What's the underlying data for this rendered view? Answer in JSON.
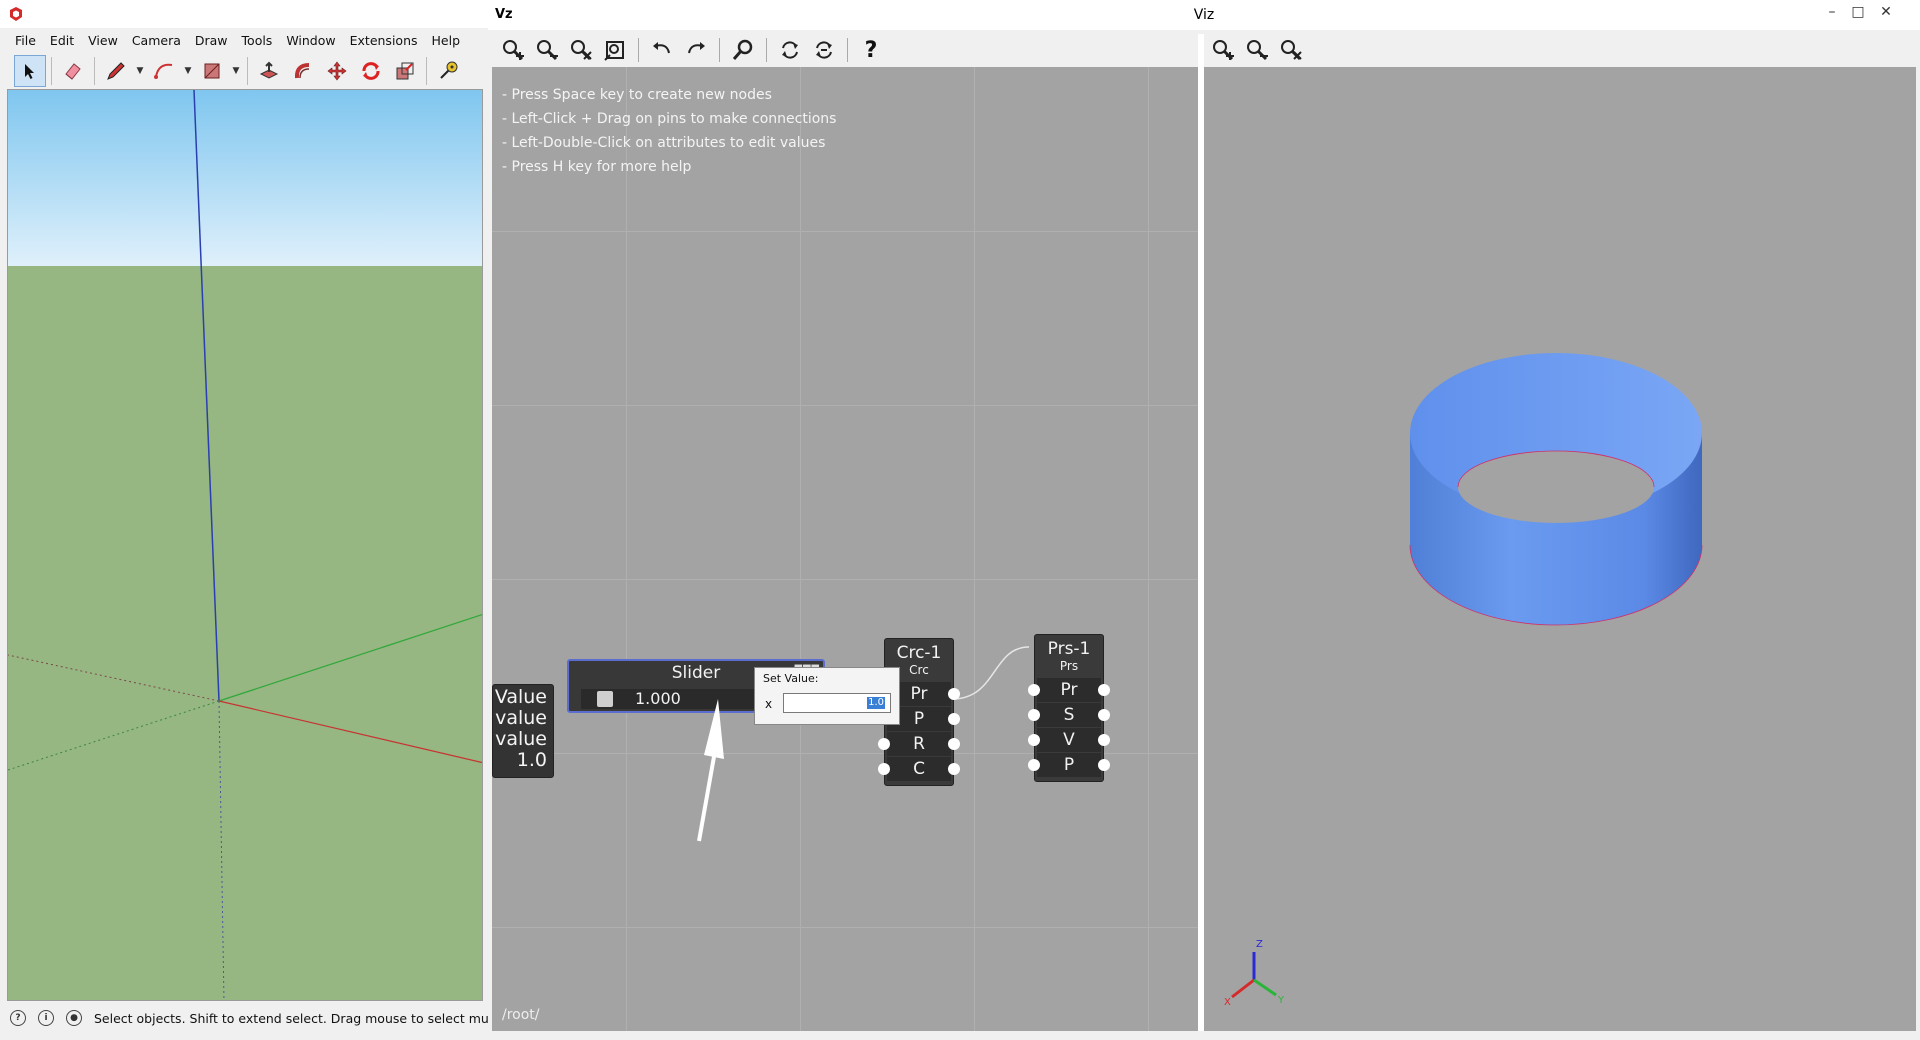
{
  "sketchup": {
    "menu": [
      "File",
      "Edit",
      "View",
      "Camera",
      "Draw",
      "Tools",
      "Window",
      "Extensions",
      "Help"
    ],
    "status_text": "Select objects. Shift to extend select. Drag mouse to select multi"
  },
  "viz": {
    "logo": "Vz",
    "window_title": "Viz",
    "help_lines": [
      "- Press Space key to create new nodes",
      "- Left-Click + Drag on pins to make connections",
      "- Left-Double-Click on attributes to edit values",
      "- Press H key for more help"
    ],
    "path": "/root/",
    "controls": {
      "minimize": "–",
      "maximize": "□",
      "close": "✕"
    },
    "graph_toolbar_icons": [
      "zoom-in-icon",
      "zoom-out-icon",
      "zoom-reset-icon",
      "fit-view-icon",
      "undo-icon",
      "redo-icon",
      "search-icon",
      "refresh-icon",
      "refresh-all-icon",
      "help-icon"
    ],
    "help_glyph": "?",
    "viewer_toolbar_icons": [
      "zoom-in-icon",
      "zoom-out-icon",
      "zoom-reset-icon"
    ]
  },
  "nodes": {
    "slider": {
      "title": "Slider",
      "value": "1.000"
    },
    "value_display": {
      "lines": [
        "Value",
        "value",
        "value",
        "1.0"
      ]
    },
    "crc": {
      "title": "Crc-1",
      "subtitle": "Crc",
      "pins": [
        "Pr",
        "P",
        "R",
        "C"
      ]
    },
    "prs": {
      "title": "Prs-1",
      "subtitle": "Prs",
      "pins": [
        "Pr",
        "S",
        "V",
        "P"
      ]
    }
  },
  "set_value_dialog": {
    "title": "Set Value:",
    "label": "x",
    "selected_text": "1.0"
  },
  "viewer": {
    "shape_color": "#5f8fe8",
    "axis_labels": [
      "Z",
      "X",
      "Y"
    ]
  }
}
